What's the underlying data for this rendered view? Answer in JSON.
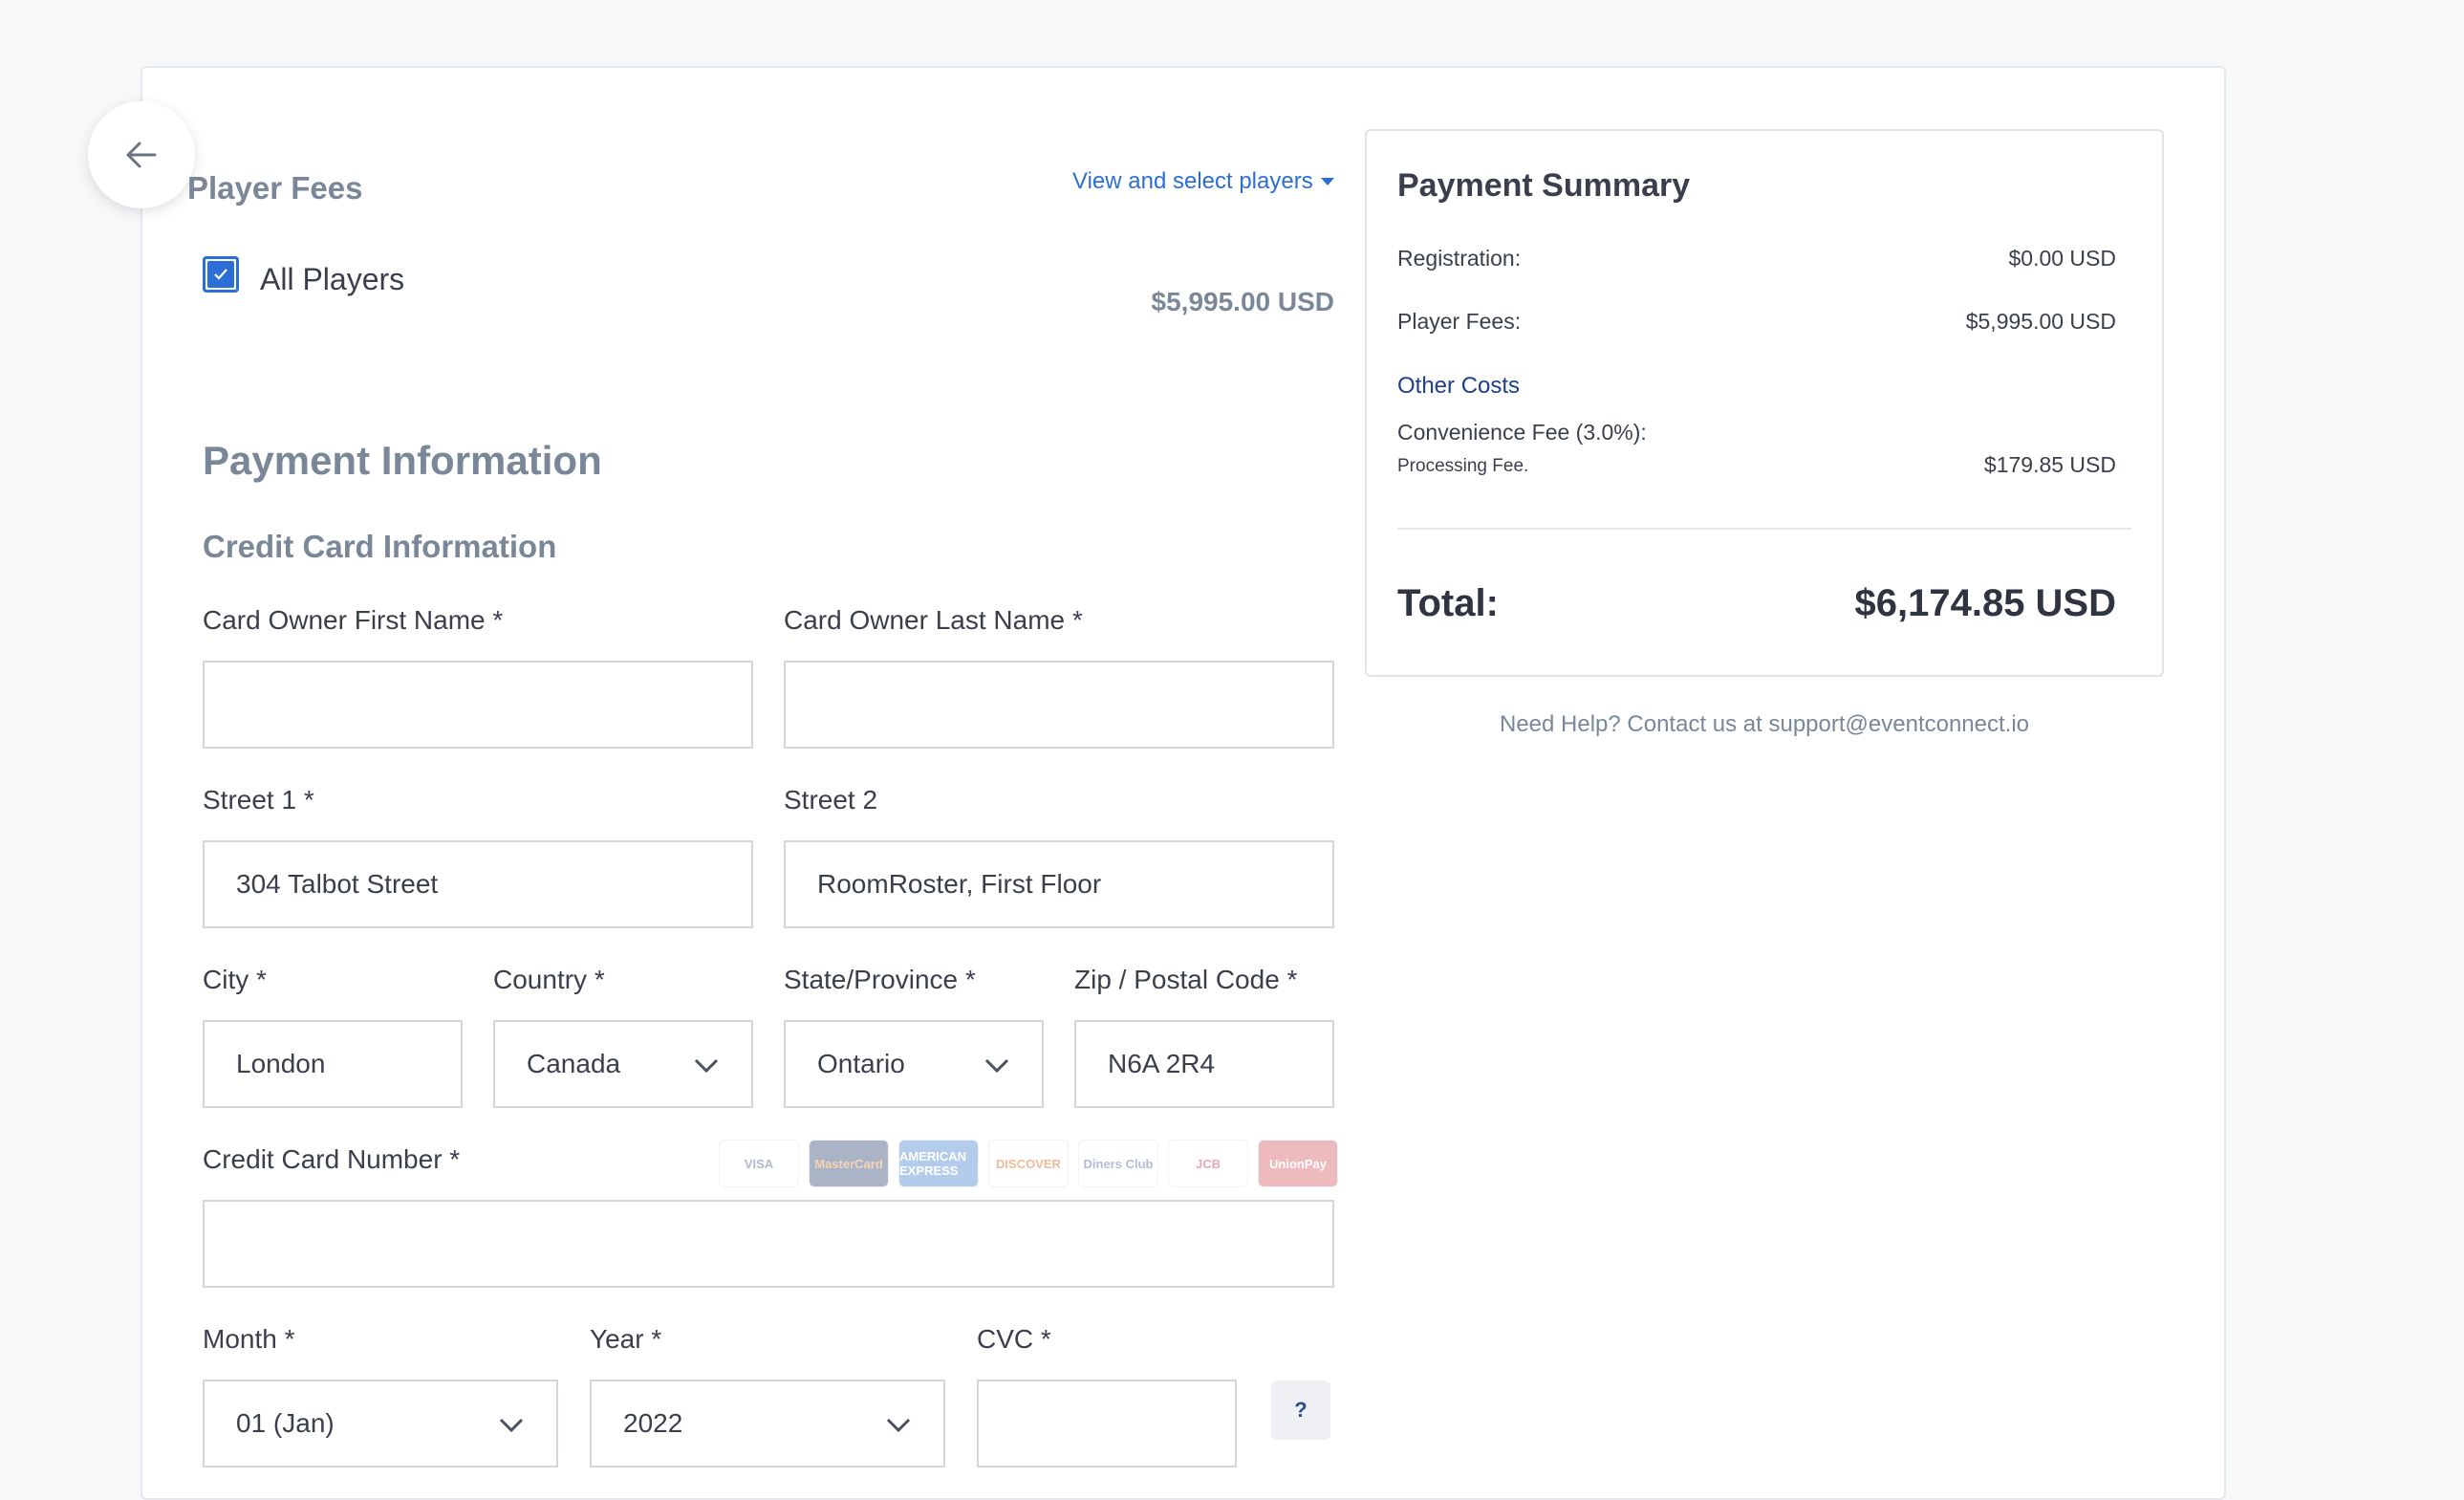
{
  "player_fees": {
    "heading": "Player Fees",
    "view_link": "View and select players",
    "all_players_label": "All Players",
    "all_players_checked": true,
    "amount": "$5,995.00 USD"
  },
  "payment_info": {
    "heading": "Payment Information",
    "cc_heading": "Credit Card Information",
    "fields": {
      "first_name": {
        "label": "Card Owner First Name *",
        "value": ""
      },
      "last_name": {
        "label": "Card Owner Last Name *",
        "value": ""
      },
      "street1": {
        "label": "Street 1 *",
        "value": "304 Talbot Street"
      },
      "street2": {
        "label": "Street 2",
        "value": "RoomRoster, First Floor"
      },
      "city": {
        "label": "City *",
        "value": "London"
      },
      "country": {
        "label": "Country *",
        "value": "Canada"
      },
      "state": {
        "label": "State/Province *",
        "value": "Ontario"
      },
      "zip": {
        "label": "Zip / Postal Code *",
        "value": "N6A 2R4"
      },
      "card_number": {
        "label": "Credit Card Number *",
        "value": ""
      },
      "month": {
        "label": "Month *",
        "value": "01 (Jan)"
      },
      "year": {
        "label": "Year *",
        "value": "2022"
      },
      "cvc": {
        "label": "CVC *",
        "value": ""
      }
    },
    "card_brands": [
      {
        "name": "visa-logo",
        "text": "VISA",
        "bg": "#ffffff",
        "fg": "#9aa3b8"
      },
      {
        "name": "mastercard-logo",
        "text": "MasterCard",
        "bg": "#8f9ab3",
        "fg": "#f3c59a"
      },
      {
        "name": "amex-logo",
        "text": "AMERICAN EXPRESS",
        "bg": "#9bbbe6",
        "fg": "#ffffff"
      },
      {
        "name": "discover-logo",
        "text": "DISCOVER",
        "bg": "#ffffff",
        "fg": "#e9a57a"
      },
      {
        "name": "diners-logo",
        "text": "Diners Club",
        "bg": "#ffffff",
        "fg": "#9aa8c8"
      },
      {
        "name": "jcb-logo",
        "text": "JCB",
        "bg": "#ffffff",
        "fg": "#d98e9b"
      },
      {
        "name": "unionpay-logo",
        "text": "UnionPay",
        "bg": "#e8a3a8",
        "fg": "#ffffff"
      }
    ],
    "cvc_help": "?"
  },
  "summary": {
    "title": "Payment Summary",
    "registration_label": "Registration:",
    "registration_value": "$0.00 USD",
    "player_fees_label": "Player Fees:",
    "player_fees_value": "$5,995.00 USD",
    "other_costs": "Other Costs",
    "convenience_label": "Convenience Fee (3.0%):",
    "processing_label": "Processing Fee.",
    "processing_value": "$179.85 USD",
    "total_label": "Total:",
    "total_value": "$6,174.85 USD"
  },
  "help_text": "Need Help? Contact us at support@eventconnect.io",
  "colors": {
    "accent": "#2b6fd6",
    "muted_heading": "#7a8799"
  }
}
